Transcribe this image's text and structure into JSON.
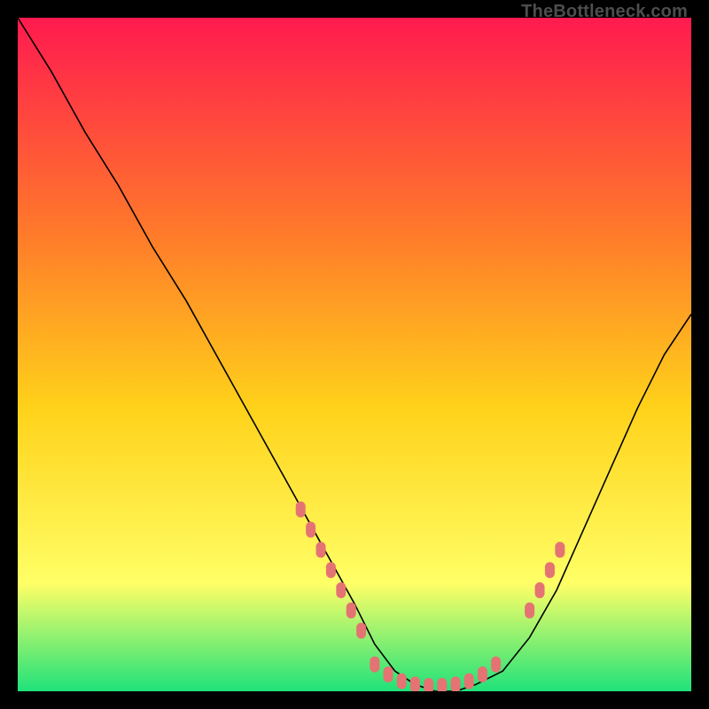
{
  "watermark": "TheBottleneck.com",
  "chart_data": {
    "type": "line",
    "title": "",
    "xlabel": "",
    "ylabel": "",
    "xlim": [
      0,
      100
    ],
    "ylim": [
      0,
      100
    ],
    "grid": false,
    "background_gradient": {
      "top": "#ff1a4f",
      "mid_upper": "#ff7a2a",
      "mid": "#ffd21a",
      "mid_lower": "#ffff66",
      "bottom": "#1fe27a"
    },
    "series": [
      {
        "name": "bottleneck-curve",
        "color": "#000000",
        "x": [
          0,
          5,
          10,
          15,
          20,
          25,
          30,
          35,
          40,
          45,
          50,
          53,
          56,
          59,
          62,
          65,
          68,
          72,
          76,
          80,
          84,
          88,
          92,
          96,
          100
        ],
        "y": [
          100,
          92,
          83,
          75,
          66,
          58,
          49,
          40,
          31,
          22,
          13,
          7,
          3,
          1,
          0,
          0,
          1,
          3,
          8,
          15,
          24,
          33,
          42,
          50,
          56
        ]
      }
    ],
    "marker_clusters": {
      "color": "#e57373",
      "clusters": [
        {
          "name": "left-wall-dots",
          "points": [
            {
              "x": 42,
              "y": 27
            },
            {
              "x": 43.5,
              "y": 24
            },
            {
              "x": 45,
              "y": 21
            },
            {
              "x": 46.5,
              "y": 18
            },
            {
              "x": 48,
              "y": 15
            },
            {
              "x": 49.5,
              "y": 12
            },
            {
              "x": 51,
              "y": 9
            }
          ]
        },
        {
          "name": "valley-floor-dots",
          "points": [
            {
              "x": 53,
              "y": 4
            },
            {
              "x": 55,
              "y": 2.5
            },
            {
              "x": 57,
              "y": 1.5
            },
            {
              "x": 59,
              "y": 1
            },
            {
              "x": 61,
              "y": 0.8
            },
            {
              "x": 63,
              "y": 0.8
            },
            {
              "x": 65,
              "y": 1
            },
            {
              "x": 67,
              "y": 1.5
            },
            {
              "x": 69,
              "y": 2.5
            },
            {
              "x": 71,
              "y": 4
            }
          ]
        },
        {
          "name": "right-wall-dots",
          "points": [
            {
              "x": 76,
              "y": 12
            },
            {
              "x": 77.5,
              "y": 15
            },
            {
              "x": 79,
              "y": 18
            },
            {
              "x": 80.5,
              "y": 21
            }
          ]
        }
      ]
    }
  }
}
